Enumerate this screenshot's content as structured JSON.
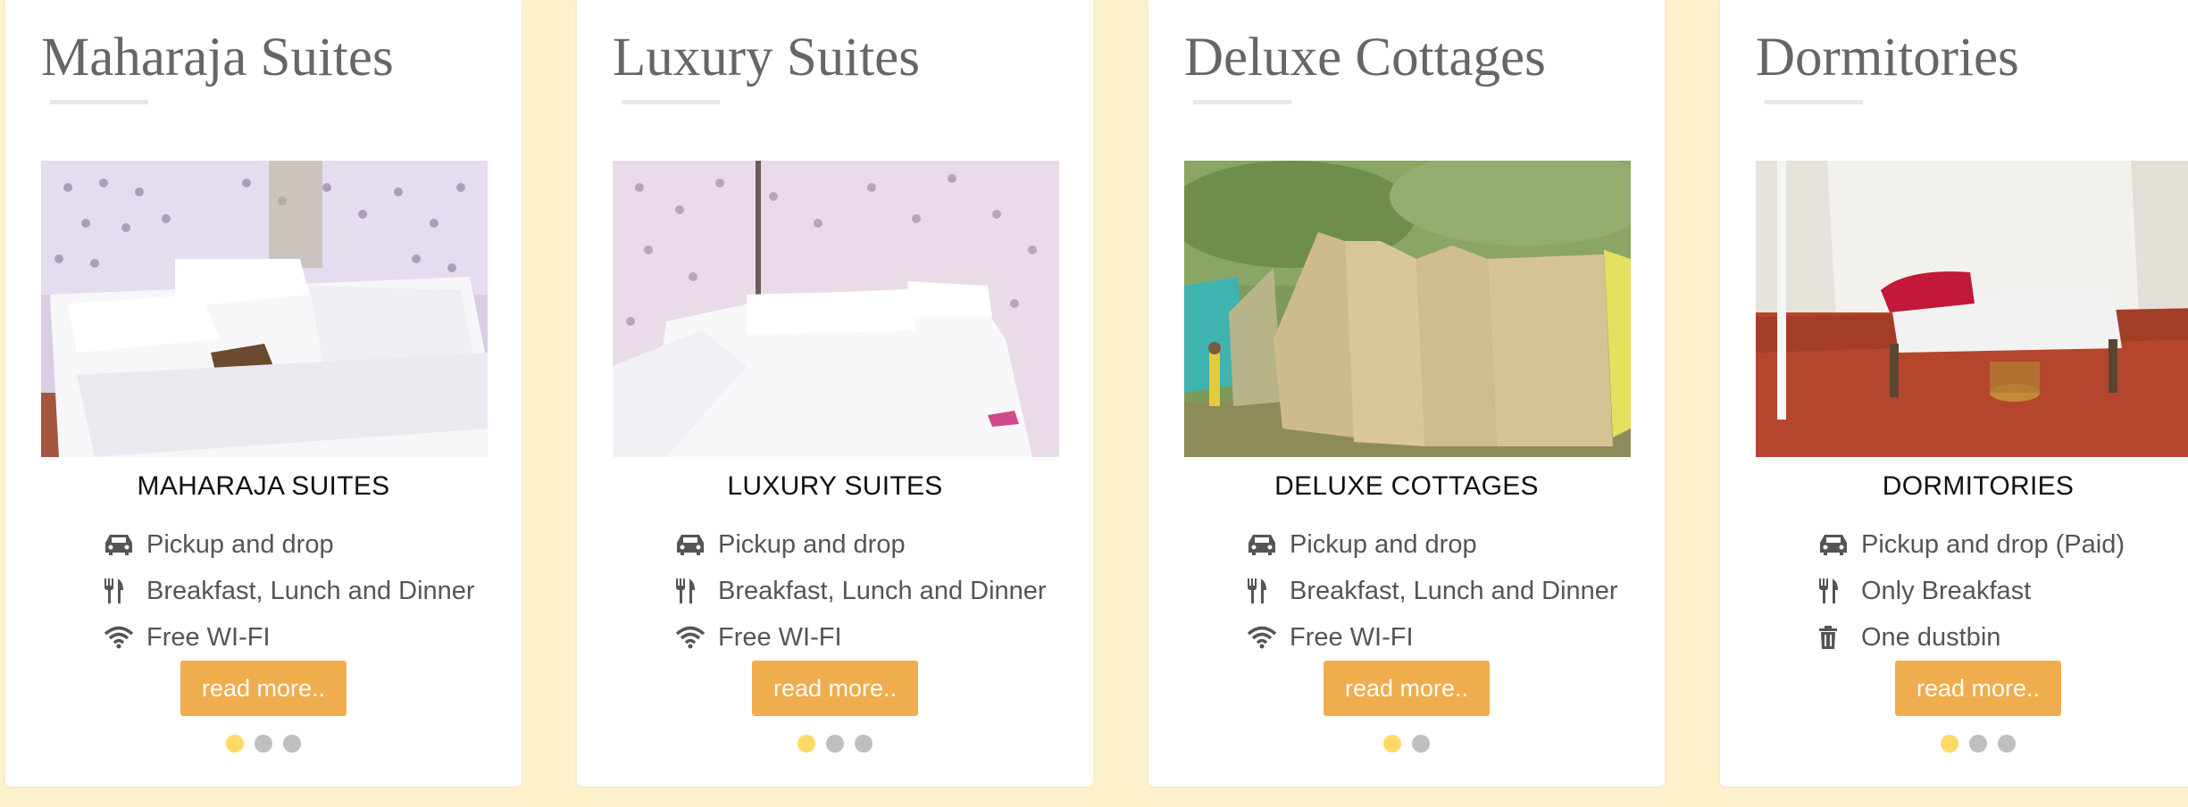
{
  "cards": [
    {
      "title": "Maharaja Suites",
      "room_name": "MAHARAJA SUITES",
      "image": "tent-bedroom-photo",
      "features": [
        {
          "icon": "car-icon",
          "text": "Pickup and drop"
        },
        {
          "icon": "cutlery-icon",
          "text": "Breakfast, Lunch and Dinner"
        },
        {
          "icon": "wifi-icon",
          "text": "Free WI-FI"
        }
      ],
      "button_label": "read more..",
      "slides": 3,
      "active_slide": 1
    },
    {
      "title": "Luxury Suites",
      "room_name": "LUXURY SUITES",
      "image": "tent-bedroom-photo",
      "features": [
        {
          "icon": "car-icon",
          "text": "Pickup and drop"
        },
        {
          "icon": "cutlery-icon",
          "text": "Breakfast, Lunch and Dinner"
        },
        {
          "icon": "wifi-icon",
          "text": "Free WI-FI"
        }
      ],
      "button_label": "read more..",
      "slides": 3,
      "active_slide": 1
    },
    {
      "title": "Deluxe Cottages",
      "room_name": "DELUXE COTTAGES",
      "image": "tents-outdoor-photo",
      "features": [
        {
          "icon": "car-icon",
          "text": "Pickup and drop"
        },
        {
          "icon": "cutlery-icon",
          "text": "Breakfast, Lunch and Dinner"
        },
        {
          "icon": "wifi-icon",
          "text": "Free WI-FI"
        }
      ],
      "button_label": "read more..",
      "slides": 2,
      "active_slide": 1
    },
    {
      "title": "Dormitories",
      "room_name": "DORMITORIES",
      "image": "dormitory-photo",
      "features": [
        {
          "icon": "car-icon",
          "text": "Pickup and drop (Paid)"
        },
        {
          "icon": "cutlery-icon",
          "text": "Only Breakfast"
        },
        {
          "icon": "trash-icon",
          "text": "One dustbin"
        }
      ],
      "button_label": "read more..",
      "slides": 3,
      "active_slide": 1
    }
  ],
  "colors": {
    "page_background": "#fdf1cc",
    "button": "#f0ad4e",
    "dot_active": "#ffd966",
    "dot_inactive": "#bfbfbf"
  }
}
